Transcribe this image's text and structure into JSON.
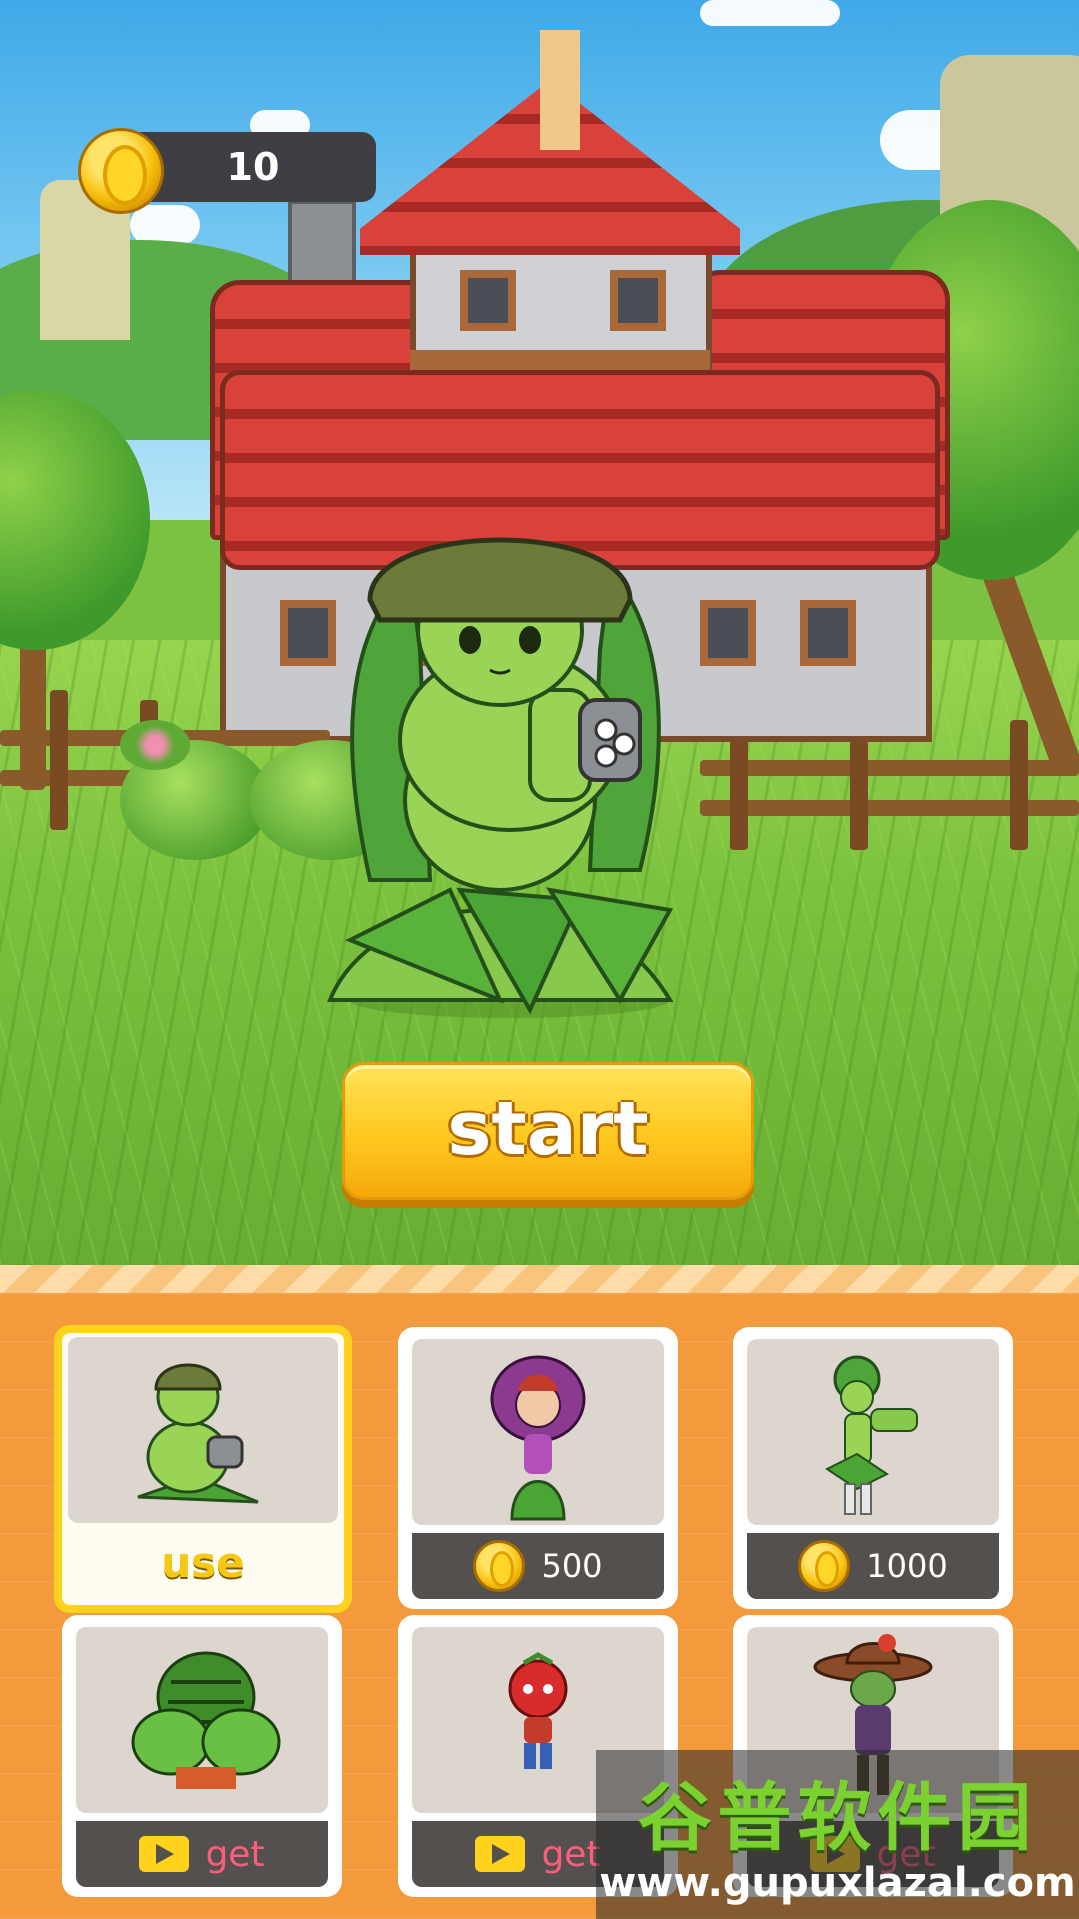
{
  "hud": {
    "coins": "10",
    "coin_icon": "gold-coin-icon"
  },
  "start_button": {
    "label": "start"
  },
  "shop": {
    "cards": [
      {
        "name": "pea-gatling-girl",
        "state": "selected",
        "action": "use"
      },
      {
        "name": "chomper-girl",
        "state": "locked",
        "price": "500"
      },
      {
        "name": "peashooter-girl",
        "state": "locked",
        "price": "1000"
      },
      {
        "name": "watermelon-brute",
        "state": "locked",
        "action": "get"
      },
      {
        "name": "tomato-kid",
        "state": "locked",
        "action": "get"
      },
      {
        "name": "cactus-cowboy",
        "state": "locked",
        "action": "get"
      }
    ]
  },
  "watermark": {
    "logo": "谷普软件园",
    "url": "www.gupuxlazal.com"
  },
  "colors": {
    "accent": "#ffc81f",
    "panel": "#f39a3c",
    "price_bar": "#54504d",
    "get_text": "#ff5b7c"
  }
}
